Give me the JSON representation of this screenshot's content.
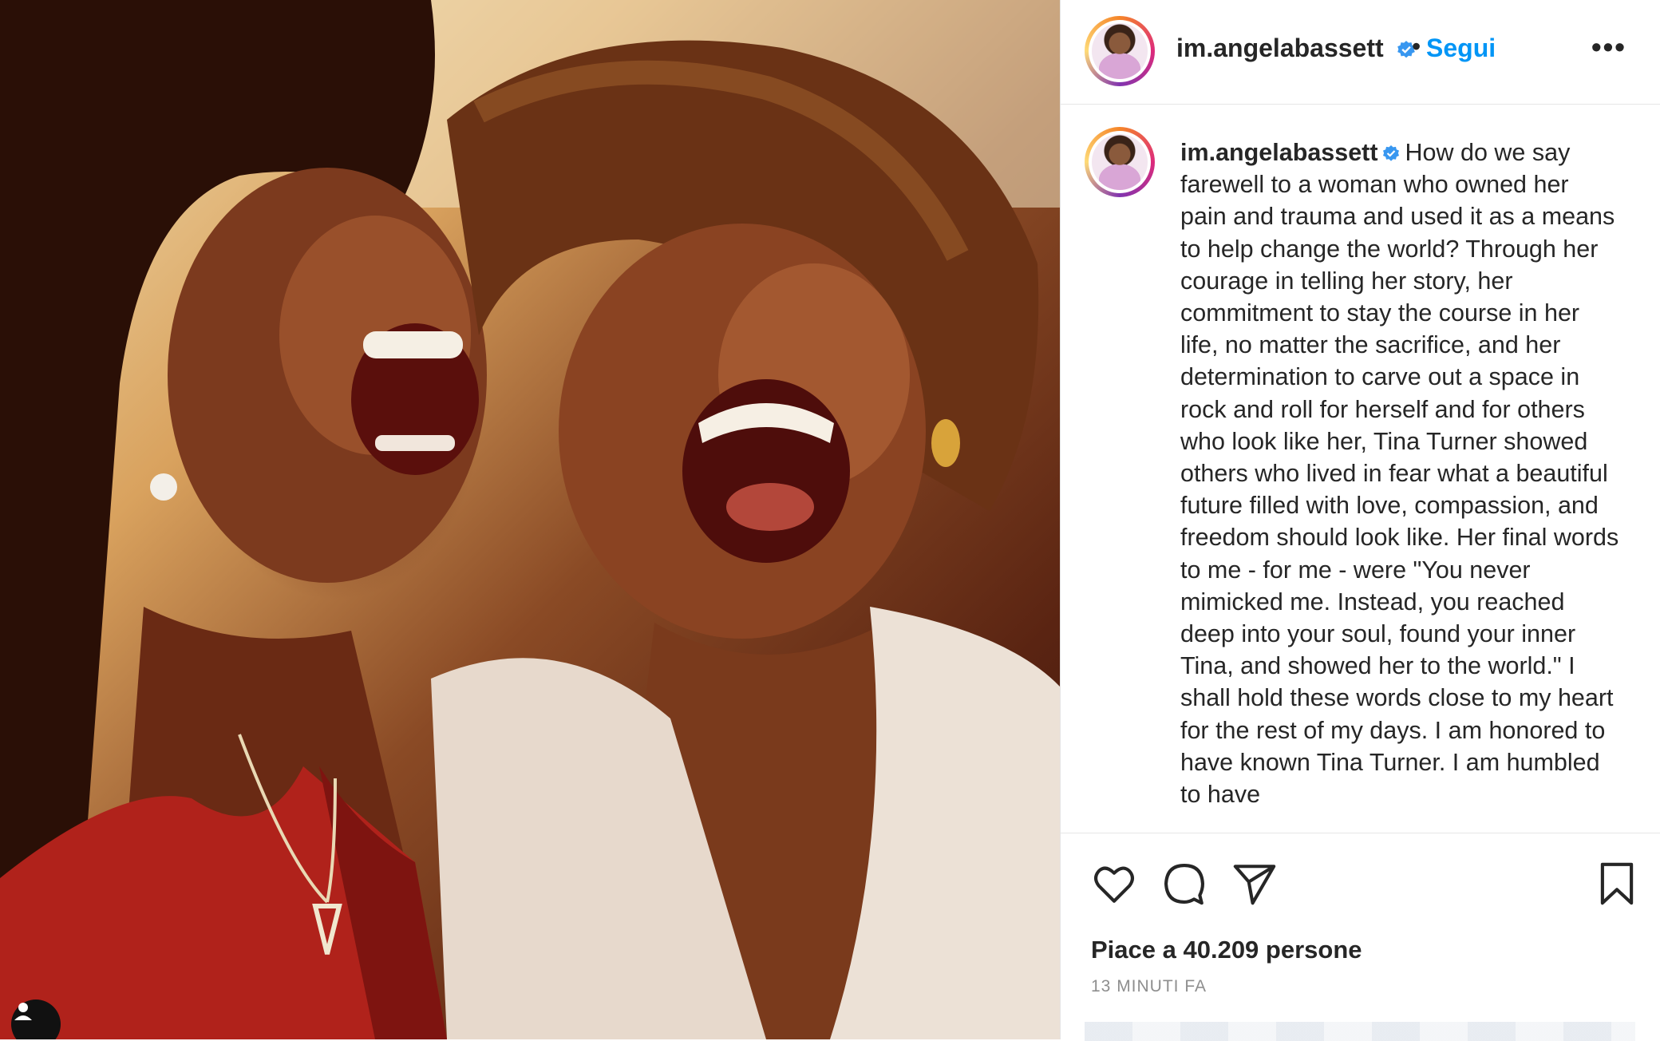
{
  "post": {
    "username": "im.angelabassett",
    "separator": "•",
    "follow_label": "Segui",
    "more_label": "•••",
    "caption": "How do we say farewell to a woman who owned her pain and trauma and used it as a means to help change the world? Through her courage in telling her story, her commitment to stay the course in her life, no matter the sacrifice, and her determination to carve out a space in rock and roll for herself and for others who look like her, Tina Turner showed others who lived in fear what a beautiful future filled with love, compassion, and freedom should look like. Her final words to me - for me - were \"You never mimicked me. Instead, you reached deep into your soul, found your inner Tina, and showed her to the world.\" I shall hold these words close to my heart for the rest of my days. I am honored to have known Tina Turner. I am humbled to have",
    "likes": "Piace a 40.209 persone",
    "timestamp": "13 MINUTI FA"
  },
  "icons": {
    "verified": "verified-badge-icon",
    "like": "heart-icon",
    "comment": "comment-icon",
    "share": "paper-plane-icon",
    "save": "bookmark-icon",
    "user": "user-icon"
  },
  "colors": {
    "follow_blue": "#0095f6",
    "verified_blue": "#3897f0",
    "text": "#262626",
    "muted": "#8e8e8e"
  }
}
